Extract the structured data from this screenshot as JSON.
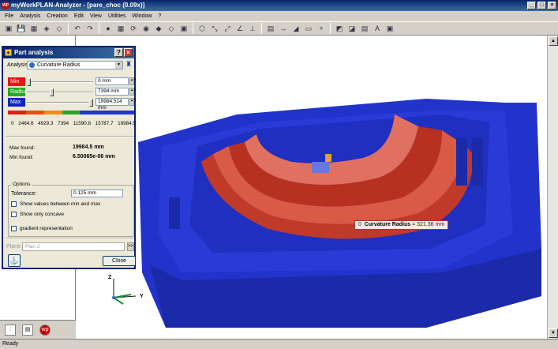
{
  "window": {
    "title": "myWorkPLAN-Analyzer - [pare_choc (0.09x)]",
    "logo": "WP"
  },
  "menu": [
    "File",
    "Analysis",
    "Creation",
    "Edit",
    "View",
    "Utilities",
    "Window",
    "?"
  ],
  "toolbar_icons": [
    "open-folder-icon",
    "save-icon",
    "tree-icon",
    "mold-icon",
    "part-icon",
    "undo-icon",
    "redo-icon",
    "sphere-icon",
    "grid-icon",
    "rotate-icon",
    "globe-icon",
    "fit-icon",
    "fit-all-icon",
    "cube-icon",
    "iso-icon",
    "measure-icon",
    "measure2-icon",
    "angle-icon",
    "axis-icon",
    "section-icon",
    "distance-icon",
    "draft-icon",
    "ruler-icon",
    "point-add-icon",
    "paint-icon",
    "clear-icon",
    "layer-icon",
    "text-icon",
    "camera-icon"
  ],
  "dialog": {
    "title": "Part analysis",
    "analysis_label": "Analysis",
    "analysis_value": "Curvature Radius",
    "min_label": "Min",
    "radius_label": "Radius",
    "max_label": "Max",
    "min_value": "0 mm",
    "radius_value": "7394 mm",
    "max_value": "19984.514 mm",
    "slider_min_pos": 0.0,
    "slider_radius_pos": 0.37,
    "slider_max_pos": 1.0,
    "scale_ticks": [
      "0",
      "2464.6",
      "4929.3",
      "7394",
      "11590.8",
      "15787.7",
      "19984.5"
    ],
    "max_found_label": "Max found:",
    "max_found_value": "19984.5 mm",
    "min_found_label": "Min found:",
    "min_found_value": "6.50065e-06 mm",
    "options_label": "Options",
    "tolerance_label": "Tolerance:",
    "tolerance_value": "0.125 mm",
    "opt_between": "Show values between min and max",
    "opt_concave": "Show only concave",
    "opt_gradient": "gradient representation",
    "plane_label": "Plane:",
    "plane_value": "Plan 2",
    "close_label": "Close",
    "colors": {
      "min": "#ee1111",
      "radius": "#22aa22",
      "max": "#1122cc"
    }
  },
  "tooltip": {
    "prefix": "0",
    "label": "Curvature Radius",
    "value": "= 321.36 mm"
  },
  "axes": {
    "z": "Z",
    "y": "Y"
  },
  "status": "Ready"
}
